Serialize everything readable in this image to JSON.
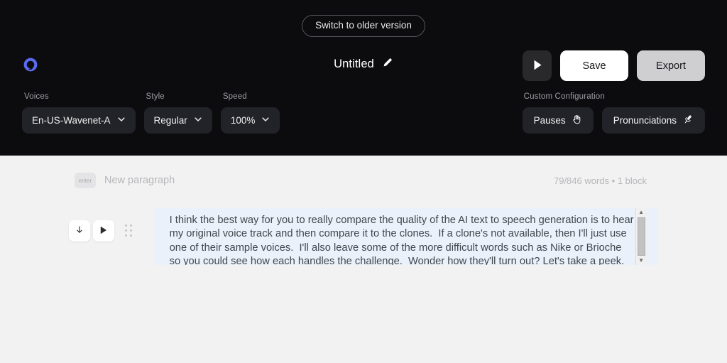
{
  "header": {
    "switch_version_label": "Switch to older version",
    "logo_name": "app-logo",
    "project_title": "Untitled",
    "edit_icon": "pencil-icon",
    "play_icon": "play-icon",
    "save_label": "Save",
    "export_label": "Export",
    "accent_color": "#5b6bf0",
    "background_color": "#0c0c0e"
  },
  "controls": {
    "voices": {
      "label": "Voices",
      "value": "En-US-Wavenet-A"
    },
    "style": {
      "label": "Style",
      "value": "Regular"
    },
    "speed": {
      "label": "Speed",
      "value": "100%"
    },
    "custom_configuration": {
      "label": "Custom Configuration",
      "pauses_label": "Pauses",
      "pauses_icon": "hand-icon",
      "pronunciations_label": "Pronunciations",
      "pronunciations_icon": "microphone-icon"
    }
  },
  "editor": {
    "key_badge": "enter",
    "new_paragraph_label": "New paragraph",
    "word_count": "79/846 words  •  1 block",
    "download_icon": "download-icon",
    "play_icon": "play-icon",
    "drag_handle_icon": "drag-handle-icon",
    "block_text": "I think the best way for you to really compare the quality of the AI text to speech generation is to hear my original voice track and then compare it to the clones.  If a clone's not available, then I'll just use one of their sample voices.  I'll also leave some of the more difficult words such as Nike or Brioche so you could see how each handles the challenge.  Wonder how they'll turn out? Let's take a peek.",
    "block_background": "#eaf1fa",
    "scroll_up_icon": "▲",
    "scroll_down_icon": "▼"
  }
}
